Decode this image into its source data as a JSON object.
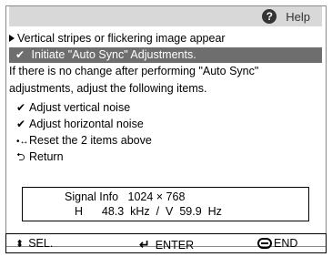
{
  "help": {
    "icon": "?",
    "label": "Help"
  },
  "topic": {
    "label": "Vertical stripes or flickering image appear"
  },
  "selected": {
    "check": "✔",
    "label": "Initiate \"Auto Sync\" Adjustments."
  },
  "instructions": {
    "line1": "If there is no change after performing \"Auto Sync\"",
    "line2": "adjustments, adjust the following items."
  },
  "items": [
    {
      "icon": "✔",
      "label": "Adjust vertical noise"
    },
    {
      "icon": "✔",
      "label": "Adjust horizontal noise"
    },
    {
      "icon": "•↔",
      "label": "Reset the 2 items above"
    },
    {
      "icon": "⮌",
      "label": "Return"
    }
  ],
  "signal_info": {
    "label": "Signal Info",
    "resolution": "1024 × 768",
    "line2": "H      48.3  kHz  /  V  59.9  Hz"
  },
  "footer": {
    "sel_icon": "⬍",
    "sel_label": "SEL.",
    "enter_icon": "↵",
    "enter_label": "ENTER",
    "end_label": "END"
  }
}
